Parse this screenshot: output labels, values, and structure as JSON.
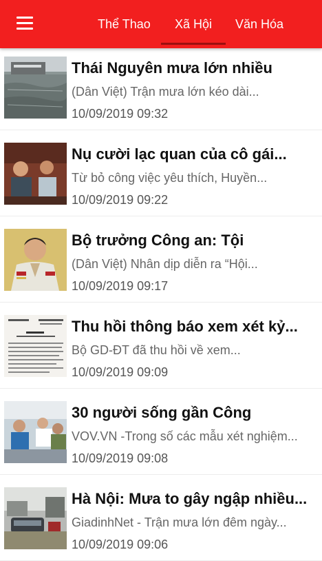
{
  "header": {
    "menu_icon": "hamburger-menu-icon",
    "tabs": [
      {
        "label": "Thể Thao"
      },
      {
        "label": "Xã Hội",
        "active": true
      },
      {
        "label": "Văn Hóa"
      }
    ],
    "colors": {
      "bar": "#f21f1f",
      "indicator": "#9b1010",
      "tab_text": "#ffffff"
    }
  },
  "articles": [
    {
      "title": "Thái Nguyên mưa lớn nhiều",
      "summary": "(Dân Việt) Trận mưa lớn kéo dài...",
      "time": "10/09/2019 09:32"
    },
    {
      "title": "Nụ cười lạc quan của cô gái...",
      "summary": "Từ bỏ công việc yêu thích, Huyền...",
      "time": "10/09/2019 09:22"
    },
    {
      "title": "Bộ trưởng Công an: Tội",
      "summary": "(Dân Việt) Nhân dịp diễn ra “Hội...",
      "time": "10/09/2019 09:17"
    },
    {
      "title": "Thu hồi thông báo xem xét kỷ...",
      "summary": "Bộ GD-ĐT đã thu hồi về xem...",
      "time": "10/09/2019 09:09"
    },
    {
      "title": "30 người sống gần Công",
      "summary": "VOV.VN -Trong số các mẫu xét nghiệm...",
      "time": "10/09/2019 09:08"
    },
    {
      "title": "Hà Nội: Mưa to gây ngập nhiều...",
      "summary": "GiadinhNet - Trận mưa lớn đêm ngày...",
      "time": "10/09/2019 09:06"
    }
  ]
}
